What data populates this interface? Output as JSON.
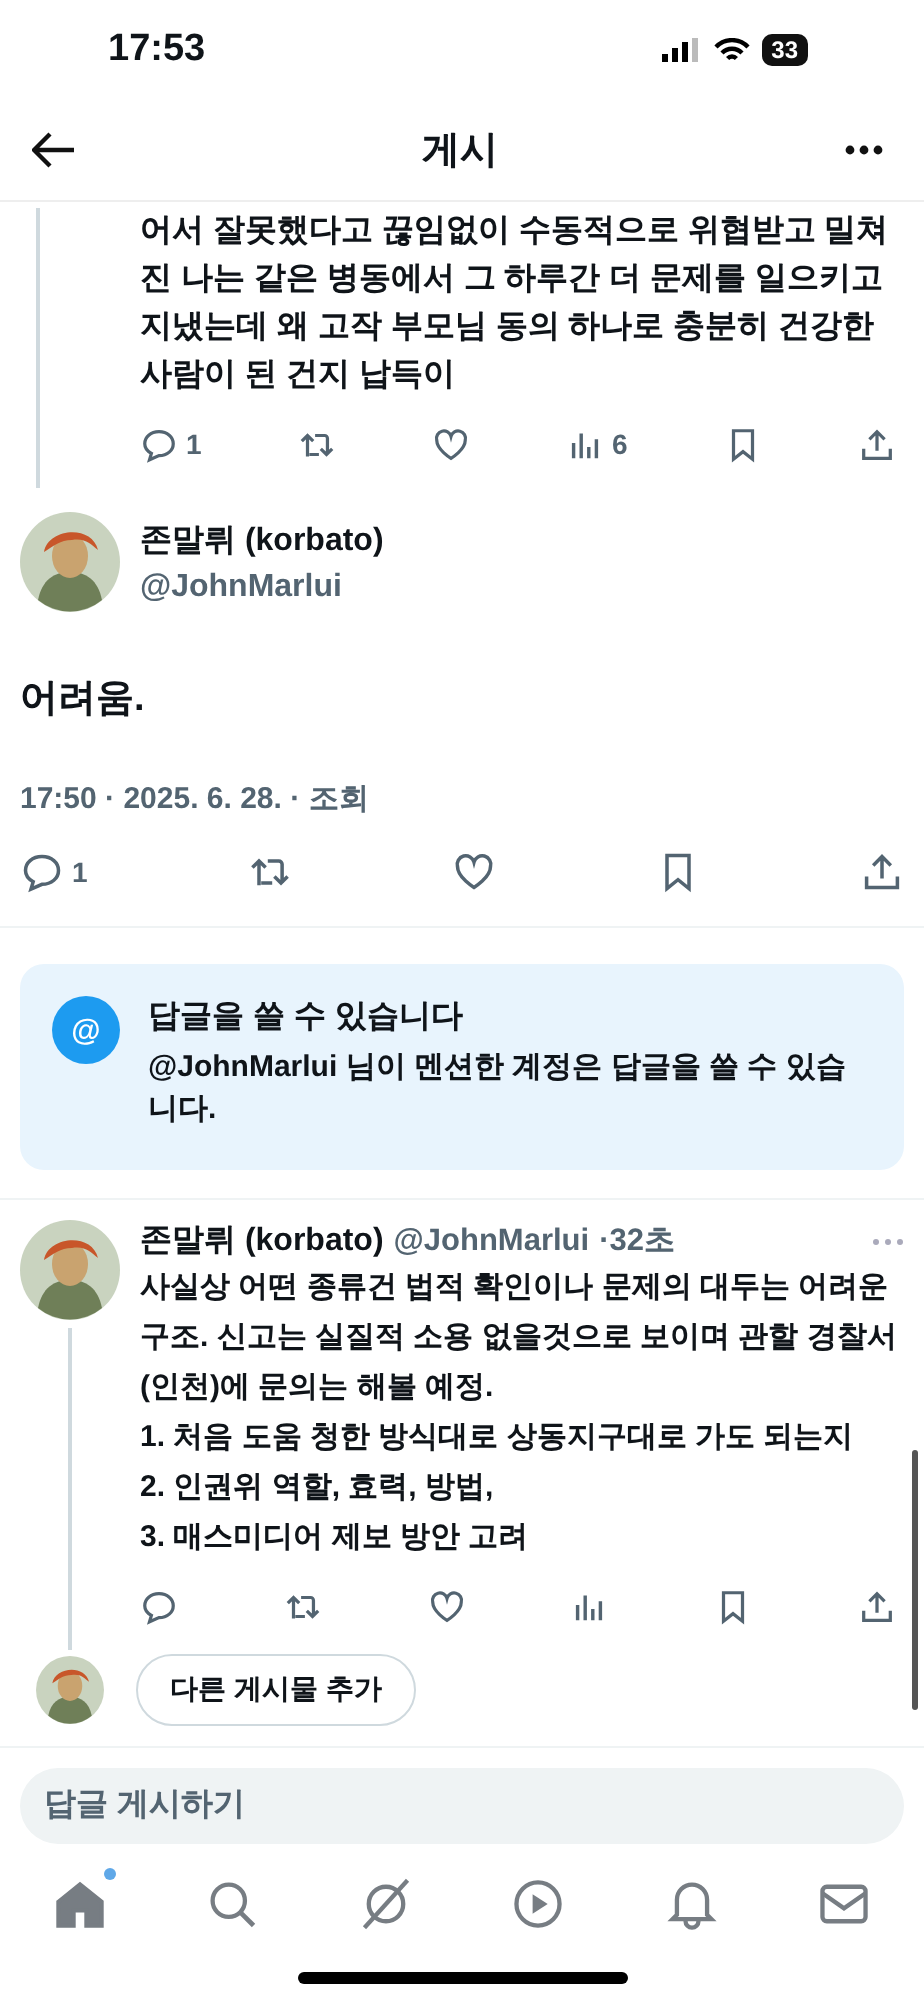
{
  "status_bar": {
    "time": "17:53",
    "battery": "33"
  },
  "header": {
    "title": "게시"
  },
  "previous_post": {
    "text": "어서 잘못했다고 끊임없이 수동적으로 위협받고 밀쳐진 나는 같은 병동에서 그 하루간 더 문제를 일으키고 지냈는데 왜 고작 부모님 동의 하나로 충분히 건강한 사람이 된 건지 납득이",
    "replies": "1",
    "views": "6"
  },
  "main_post": {
    "name": "존말뤼 (korbato)",
    "handle": "@JohnMarlui",
    "text": "어려움.",
    "meta": "17:50 · 2025. 6. 28. · 조회",
    "replies": "1"
  },
  "notice": {
    "icon": "@",
    "title": "답글을 쓸 수 있습니다",
    "body": "**@JohnMarlui** 님이 멘션한 계정은 답글을 쓸 수 있습니다."
  },
  "reply": {
    "name": "존말뤼 (korbato)",
    "handle": "@JohnMarlui",
    "time": "·32초",
    "paragraphs": [
      "사실상 어떤 종류건 법적 확인이나 문제의 대두는 어려운 구조. 신고는 실질적 소용 없을것으로 보이며 관할 경찰서(인천)에 문의는 해볼 예정.",
      "1. 처음 도움 청한 방식대로 상동지구대로 가도 되는지",
      "2. 인권위 역할, 효력, 방법,",
      "3. 매스미디어 제보 방안 고려"
    ]
  },
  "add_post": {
    "label": "다른 게시물 추가"
  },
  "reply_field": {
    "placeholder": "답글 게시하기"
  },
  "nav": [
    {
      "kind": "home",
      "selected": true,
      "badge": true
    },
    {
      "kind": "search",
      "selected": false,
      "badge": false
    },
    {
      "kind": "grok",
      "selected": false,
      "badge": false
    },
    {
      "kind": "video",
      "selected": false,
      "badge": false
    },
    {
      "kind": "notifications",
      "selected": false,
      "badge": false
    },
    {
      "kind": "messages",
      "selected": false,
      "badge": false
    }
  ]
}
